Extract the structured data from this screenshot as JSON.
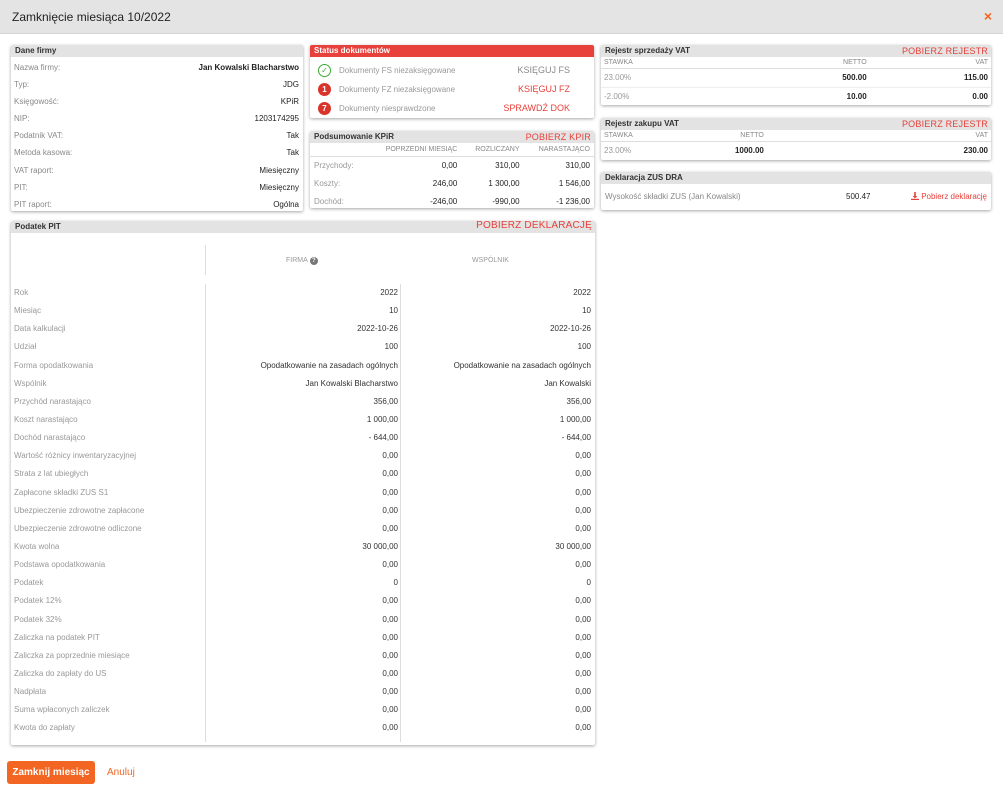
{
  "window": {
    "title": "Zamknięcie miesiąca 10/2022",
    "close_icon": "×"
  },
  "company": {
    "header": "Dane firmy",
    "rows": [
      {
        "label": "Nazwa firmy:",
        "value": "Jan Kowalski Blacharstwo"
      },
      {
        "label": "Typ:",
        "value": "JDG"
      },
      {
        "label": "Księgowość:",
        "value": "KPiR"
      },
      {
        "label": "NIP:",
        "value": "1203174295"
      },
      {
        "label": "Podatnik VAT:",
        "value": "Tak"
      },
      {
        "label": "Metoda kasowa:",
        "value": "Tak"
      },
      {
        "label": "VAT raport:",
        "value": "Miesięczny"
      },
      {
        "label": "PIT:",
        "value": "Miesięczny"
      },
      {
        "label": "PIT raport:",
        "value": "Ogólna"
      }
    ]
  },
  "status": {
    "header": "Status dokumentów",
    "rows": [
      {
        "icon": "✓",
        "label": "Dokumenty FS niezaksięgowane",
        "action": "KSIĘGUJ FS"
      },
      {
        "icon": "1",
        "label": "Dokumenty FZ niezaksięgowane",
        "action": "KSIĘGUJ FZ"
      },
      {
        "icon": "7",
        "label": "Dokumenty niesprawdzone",
        "action": "SPRAWDŹ DOK"
      }
    ]
  },
  "kpir": {
    "header": "Podsumowanie KPiR",
    "action": "POBIERZ KPIR",
    "columns": [
      "POPRZEDNI MIESIĄC",
      "ROZLICZANY",
      "NARASTAJĄCO"
    ],
    "rows": [
      {
        "label": "Przychody:",
        "values": [
          "0,00",
          "310,00",
          "310,00"
        ]
      },
      {
        "label": "Koszty:",
        "values": [
          "246,00",
          "1 300,00",
          "1 546,00"
        ]
      },
      {
        "label": "Dochód:",
        "values": [
          "-246,00",
          "-990,00",
          "-1 236,00"
        ]
      }
    ]
  },
  "sales_vat": {
    "header": "Rejestr sprzedaży VAT",
    "action": "POBIERZ REJESTR",
    "columns": [
      "STAWKA",
      "NETTO",
      "VAT"
    ],
    "rows": [
      {
        "rate": "23.00%",
        "net": "500.00",
        "vat": "115.00"
      },
      {
        "rate": "-2.00%",
        "net": "10.00",
        "vat": "0.00"
      }
    ]
  },
  "purchase_vat": {
    "header": "Rejestr zakupu VAT",
    "action": "POBIERZ REJESTR",
    "columns": [
      "STAWKA",
      "NETTO",
      "VAT"
    ],
    "rows": [
      {
        "rate": "23.00%",
        "net": "1000.00",
        "vat": "230.00"
      }
    ]
  },
  "zus": {
    "header": "Deklaracja ZUS DRA",
    "label": "Wysokość składki ZUS (Jan Kowalski)",
    "value": "500.47",
    "action": "Pobierz deklarację"
  },
  "pit": {
    "header": "Podatek PIT",
    "action": "POBIERZ DEKLARACJĘ",
    "col_firm": "FIRMA",
    "col_partner": "WSPÓLNIK",
    "rows": [
      {
        "label": "Rok",
        "firm": "2022",
        "partner": "2022"
      },
      {
        "label": "Miesiąc",
        "firm": "10",
        "partner": "10"
      },
      {
        "label": "Data kalkulacji",
        "firm": "2022-10-26",
        "partner": "2022-10-26"
      },
      {
        "label": "Udział",
        "firm": "100",
        "partner": "100"
      },
      {
        "label": "Forma opodatkowania",
        "firm": "Opodatkowanie na zasadach ogólnych",
        "partner": "Opodatkowanie na zasadach ogólnych"
      },
      {
        "label": "Wspólnik",
        "firm": "Jan Kowalski Blacharstwo",
        "partner": "Jan Kowalski"
      },
      {
        "label": "Przychód narastająco",
        "firm": "356,00",
        "partner": "356,00"
      },
      {
        "label": "Koszt narastająco",
        "firm": "1 000,00",
        "partner": "1 000,00"
      },
      {
        "label": "Dochód narastająco",
        "firm": "- 644,00",
        "partner": "- 644,00"
      },
      {
        "label": "Wartość różnicy inwentaryzacyjnej",
        "firm": "0,00",
        "partner": "0,00"
      },
      {
        "label": "Strata z lat ubiegłych",
        "firm": "0,00",
        "partner": "0,00"
      },
      {
        "label": "Zapłacone składki ZUS S1",
        "firm": "0,00",
        "partner": "0,00"
      },
      {
        "label": "Ubezpieczenie zdrowotne zapłacone",
        "firm": "0,00",
        "partner": "0,00"
      },
      {
        "label": "Ubezpieczenie zdrowotne odliczone",
        "firm": "0,00",
        "partner": "0,00"
      },
      {
        "label": "Kwota wolna",
        "firm": "30 000,00",
        "partner": "30 000,00"
      },
      {
        "label": "Podstawa opodatkowania",
        "firm": "0,00",
        "partner": "0,00"
      },
      {
        "label": "Podatek",
        "firm": "0",
        "partner": "0"
      },
      {
        "label": "Podatek 12%",
        "firm": "0,00",
        "partner": "0,00"
      },
      {
        "label": "Podatek 32%",
        "firm": "0,00",
        "partner": "0,00"
      },
      {
        "label": "Zaliczka na podatek PIT",
        "firm": "0,00",
        "partner": "0,00"
      },
      {
        "label": "Zaliczka za poprzednie miesiące",
        "firm": "0,00",
        "partner": "0,00"
      },
      {
        "label": "Zaliczka do zapłaty do US",
        "firm": "0,00",
        "partner": "0,00"
      },
      {
        "label": "Nadpłata",
        "firm": "0,00",
        "partner": "0,00"
      },
      {
        "label": "Suma wpłaconych zaliczek",
        "firm": "0,00",
        "partner": "0,00"
      },
      {
        "label": "Kwota do zapłaty",
        "firm": "0,00",
        "partner": "0,00"
      }
    ]
  },
  "footer": {
    "primary": "Zamknij miesiąc",
    "secondary": "Anuluj"
  },
  "colors": {
    "accent": "#f26522",
    "danger": "#e8403a",
    "ok": "#3aaa35"
  }
}
